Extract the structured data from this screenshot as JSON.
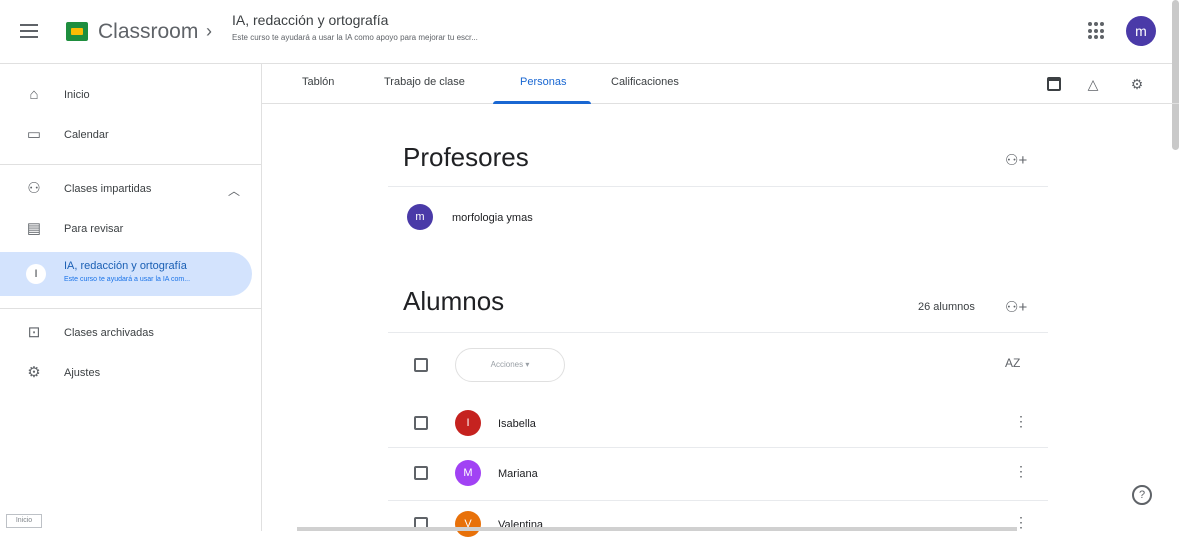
{
  "header": {
    "brand": "Classroom",
    "separator": "›",
    "class_title": "IA, redacción y ortografía",
    "class_subtitle": "Este curso te ayudará a usar la IA como apoyo para mejorar tu escr...",
    "user_initial": "m"
  },
  "sidebar": {
    "items": [
      {
        "label": "Inicio",
        "icon": "home-icon"
      },
      {
        "label": "Calendar",
        "icon": "calendar-icon"
      },
      {
        "label": "Clases impartidas",
        "icon": "people-icon"
      },
      {
        "label": "Para revisar",
        "icon": "review-icon"
      },
      {
        "label": "IA, redacción y ortografía",
        "sub": "Este curso te ayudará a usar la IA com...",
        "initial": "I"
      },
      {
        "label": "Clases archivadas",
        "icon": "archive-icon"
      },
      {
        "label": "Ajustes",
        "icon": "gear-icon"
      }
    ]
  },
  "tabs": [
    {
      "label": "Tablón"
    },
    {
      "label": "Trabajo de clase"
    },
    {
      "label": "Personas"
    },
    {
      "label": "Calificaciones"
    }
  ],
  "teachers": {
    "title": "Profesores",
    "list": [
      {
        "name": "morfologia ymas",
        "initial": "m",
        "color": "#4a3aa8"
      }
    ]
  },
  "students": {
    "title": "Alumnos",
    "count": "26 alumnos",
    "actions_label": "Acciones ▾",
    "sort_label": "AZ",
    "list": [
      {
        "name": "Isabella",
        "initial": "I",
        "color": "#c5221f"
      },
      {
        "name": "Mariana",
        "initial": "M",
        "color": "#a142f4"
      },
      {
        "name": "Valentina",
        "initial": "V",
        "color": "#e8710a"
      }
    ]
  },
  "footer": {
    "tag": "Inicio"
  },
  "colors": {
    "accent": "#1967d2",
    "active_bg": "#d3e3fd"
  }
}
